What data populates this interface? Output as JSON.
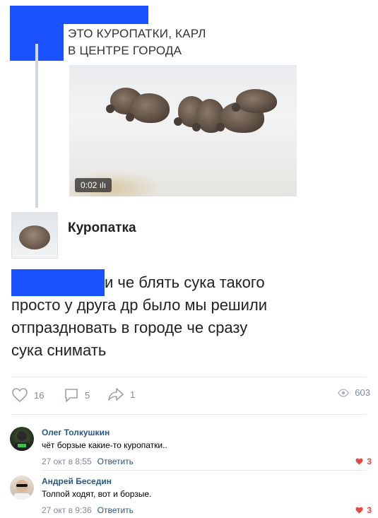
{
  "repost": {
    "caption_line1": "ЭТО КУРОПАТКИ, КАРЛ",
    "caption_line2": "В ЦЕНТРЕ ГОРОДА",
    "video": {
      "duration": "0:02 ılı"
    }
  },
  "link_card": {
    "title": "Куропатка"
  },
  "post": {
    "text_line1": "и че блять сука такого",
    "text_line2": "просто у друга др было мы решили",
    "text_line3": "отпраздновать в городе че сразу",
    "text_line4": "сука снимать"
  },
  "actions": {
    "likes": "16",
    "comments": "5",
    "shares": "1",
    "views": "603"
  },
  "comments": [
    {
      "author": "Олег Толкушкин",
      "text": "чёт борзые какие-то куропатки..",
      "date": "27 окт в 8:55",
      "reply": "Ответить",
      "likes": "3"
    },
    {
      "author": "Андрей Беседин",
      "text": "Толпой ходят, вот и борзые.",
      "date": "27 окт в 9:36",
      "reply": "Ответить",
      "likes": "3"
    }
  ],
  "colors": {
    "link": "#2a5885",
    "meta": "#828a99",
    "like_red": "#e64646",
    "redaction": "#1a52ff"
  }
}
